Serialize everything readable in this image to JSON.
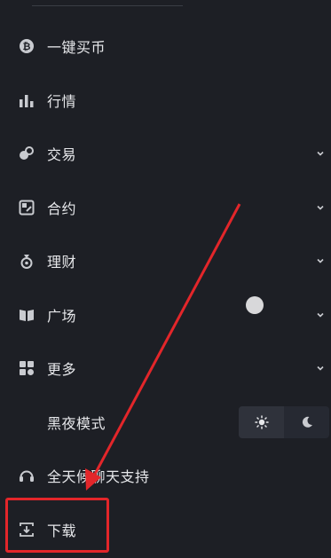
{
  "menu": {
    "items": [
      {
        "label": "一键买币",
        "icon": "bitcoin-icon",
        "has_chevron": false
      },
      {
        "label": "行情",
        "icon": "bar-chart-icon",
        "has_chevron": false
      },
      {
        "label": "交易",
        "icon": "exchange-icon",
        "has_chevron": true
      },
      {
        "label": "合约",
        "icon": "contract-icon",
        "has_chevron": true
      },
      {
        "label": "理财",
        "icon": "money-bag-icon",
        "has_chevron": true
      },
      {
        "label": "广场",
        "icon": "book-icon",
        "has_chevron": true
      },
      {
        "label": "更多",
        "icon": "grid-icon",
        "has_chevron": true
      },
      {
        "label": "黑夜模式",
        "icon": "",
        "has_chevron": false
      },
      {
        "label": "全天候聊天支持",
        "icon": "headset-icon",
        "has_chevron": false
      },
      {
        "label": "下载",
        "icon": "download-icon",
        "has_chevron": false
      }
    ]
  },
  "theme_toggle": {
    "options": [
      {
        "name": "light",
        "icon": "sun-icon"
      },
      {
        "name": "dark",
        "icon": "moon-icon"
      }
    ]
  },
  "colors": {
    "background": "#1d1f25",
    "text": "#e6e7ea",
    "icon": "#c9cbd0",
    "annotation": "#e3262a"
  }
}
